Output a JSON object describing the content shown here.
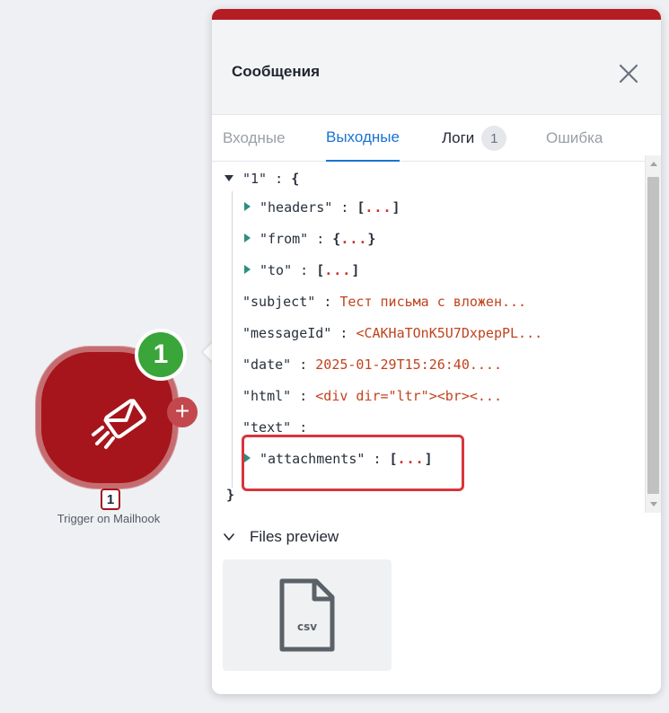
{
  "node": {
    "badge_count": "1",
    "operation_number": "1",
    "label": "Trigger on Mailhook",
    "add_symbol": "+",
    "icon": "mail-trigger-icon",
    "color": "#a6151b"
  },
  "panel": {
    "title": "Сообщения",
    "close_icon": "close-icon",
    "accent_color": "#b51d22",
    "tabs": [
      {
        "label": "Входные",
        "state": "inactive"
      },
      {
        "label": "Выходные",
        "state": "active"
      },
      {
        "label": "Логи",
        "state": "normal",
        "count": "1"
      },
      {
        "label": "Ошибка",
        "state": "inactive"
      }
    ]
  },
  "tree": {
    "root_key": "\"1\"",
    "colon": ":",
    "open_brace": "{",
    "close_brace": "}",
    "rows": [
      {
        "key": "\"headers\"",
        "open": "[",
        "dots": "...",
        "close": "]"
      },
      {
        "key": "\"from\"",
        "open": "{",
        "dots": "...",
        "close": "}"
      },
      {
        "key": "\"to\"",
        "open": "[",
        "dots": "...",
        "close": "]"
      },
      {
        "key": "\"subject\"",
        "value": "Тест письма с вложен..."
      },
      {
        "key": "\"messageId\"",
        "value": "<CAKHaTOnK5U7DxpepPL..."
      },
      {
        "key": "\"date\"",
        "value": "2025-01-29T15:26:40...."
      },
      {
        "key": "\"html\"",
        "value": "<div dir=\"ltr\"><br><..."
      },
      {
        "key": "\"text\"",
        "value": ""
      },
      {
        "key": "\"attachments\"",
        "open": "[",
        "dots": "...",
        "close": "]"
      }
    ]
  },
  "files_preview": {
    "label": "Files preview",
    "file_ext": "csv"
  }
}
